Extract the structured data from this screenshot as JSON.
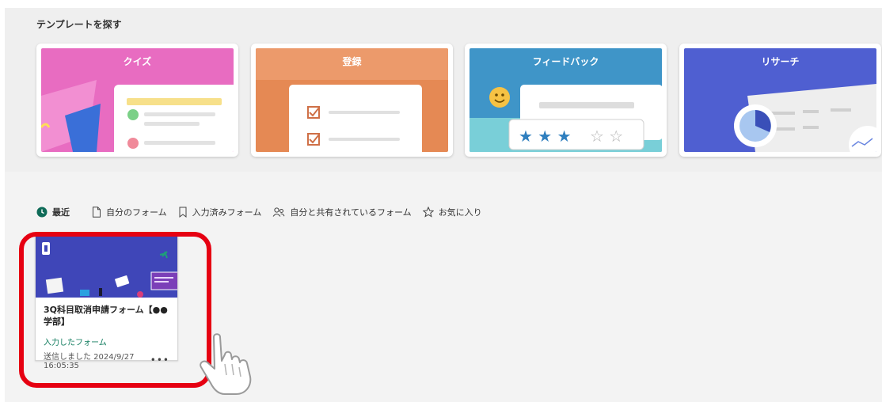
{
  "templates": {
    "heading": "テンプレートを探す",
    "cards": [
      {
        "label": "クイズ"
      },
      {
        "label": "登録"
      },
      {
        "label": "フィードバック"
      },
      {
        "label": "リサーチ"
      }
    ]
  },
  "tabs": [
    {
      "label": "最近",
      "icon": "clock-icon",
      "active": true
    },
    {
      "label": "自分のフォーム",
      "icon": "document-icon"
    },
    {
      "label": "入力済みフォーム",
      "icon": "bookmark-icon"
    },
    {
      "label": "自分と共有されているフォーム",
      "icon": "people-icon"
    },
    {
      "label": "お気に入り",
      "icon": "star-icon"
    }
  ],
  "recent_forms": [
    {
      "title": "3Q科目取消申請フォーム【●●学部】",
      "type": "入力したフォーム",
      "status": "送信しました 2024/9/27 16:05:35",
      "more": "•••"
    }
  ],
  "colors": {
    "highlight": "#e60012",
    "accent": "#0f7b5d"
  }
}
